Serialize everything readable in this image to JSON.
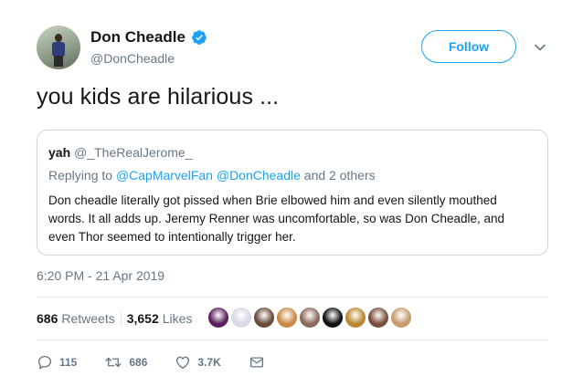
{
  "author": {
    "name": "Don Cheadle",
    "handle": "@DonCheadle"
  },
  "follow_label": "Follow",
  "tweet": {
    "text": "you kids are hilarious ...",
    "timestamp": "6:20 PM - 21 Apr 2019"
  },
  "quote": {
    "name": "yah",
    "handle": "@_TheRealJerome_",
    "reply_prefix": "Replying to",
    "reply_handles": "@CapMarvelFan @DonCheadle",
    "reply_suffix": "and 2 others",
    "body": "Don cheadle literally got pissed when Brie elbowed him and even silently mouthed words. It all adds up. Jeremy Renner was uncomfortable, so was Don Cheadle, and even Thor seemed to intentionally trigger her."
  },
  "stats": {
    "retweets_count": "686",
    "retweets_label": "Retweets",
    "likes_count": "3,652",
    "likes_label": "Likes"
  },
  "likers": [
    {
      "color": "#5a1f5e"
    },
    {
      "color": "#d8d8e6"
    },
    {
      "color": "#6b4a3a"
    },
    {
      "color": "#c98a45"
    },
    {
      "color": "#8a6a5a"
    },
    {
      "color": "#111111"
    },
    {
      "color": "#b9872f"
    },
    {
      "color": "#7a4e3c"
    },
    {
      "color": "#c89a6e"
    }
  ],
  "actions": {
    "replies": "115",
    "retweets": "686",
    "likes": "3.7K"
  },
  "colors": {
    "accent": "#1da1f2",
    "secondary_text": "#657786"
  }
}
